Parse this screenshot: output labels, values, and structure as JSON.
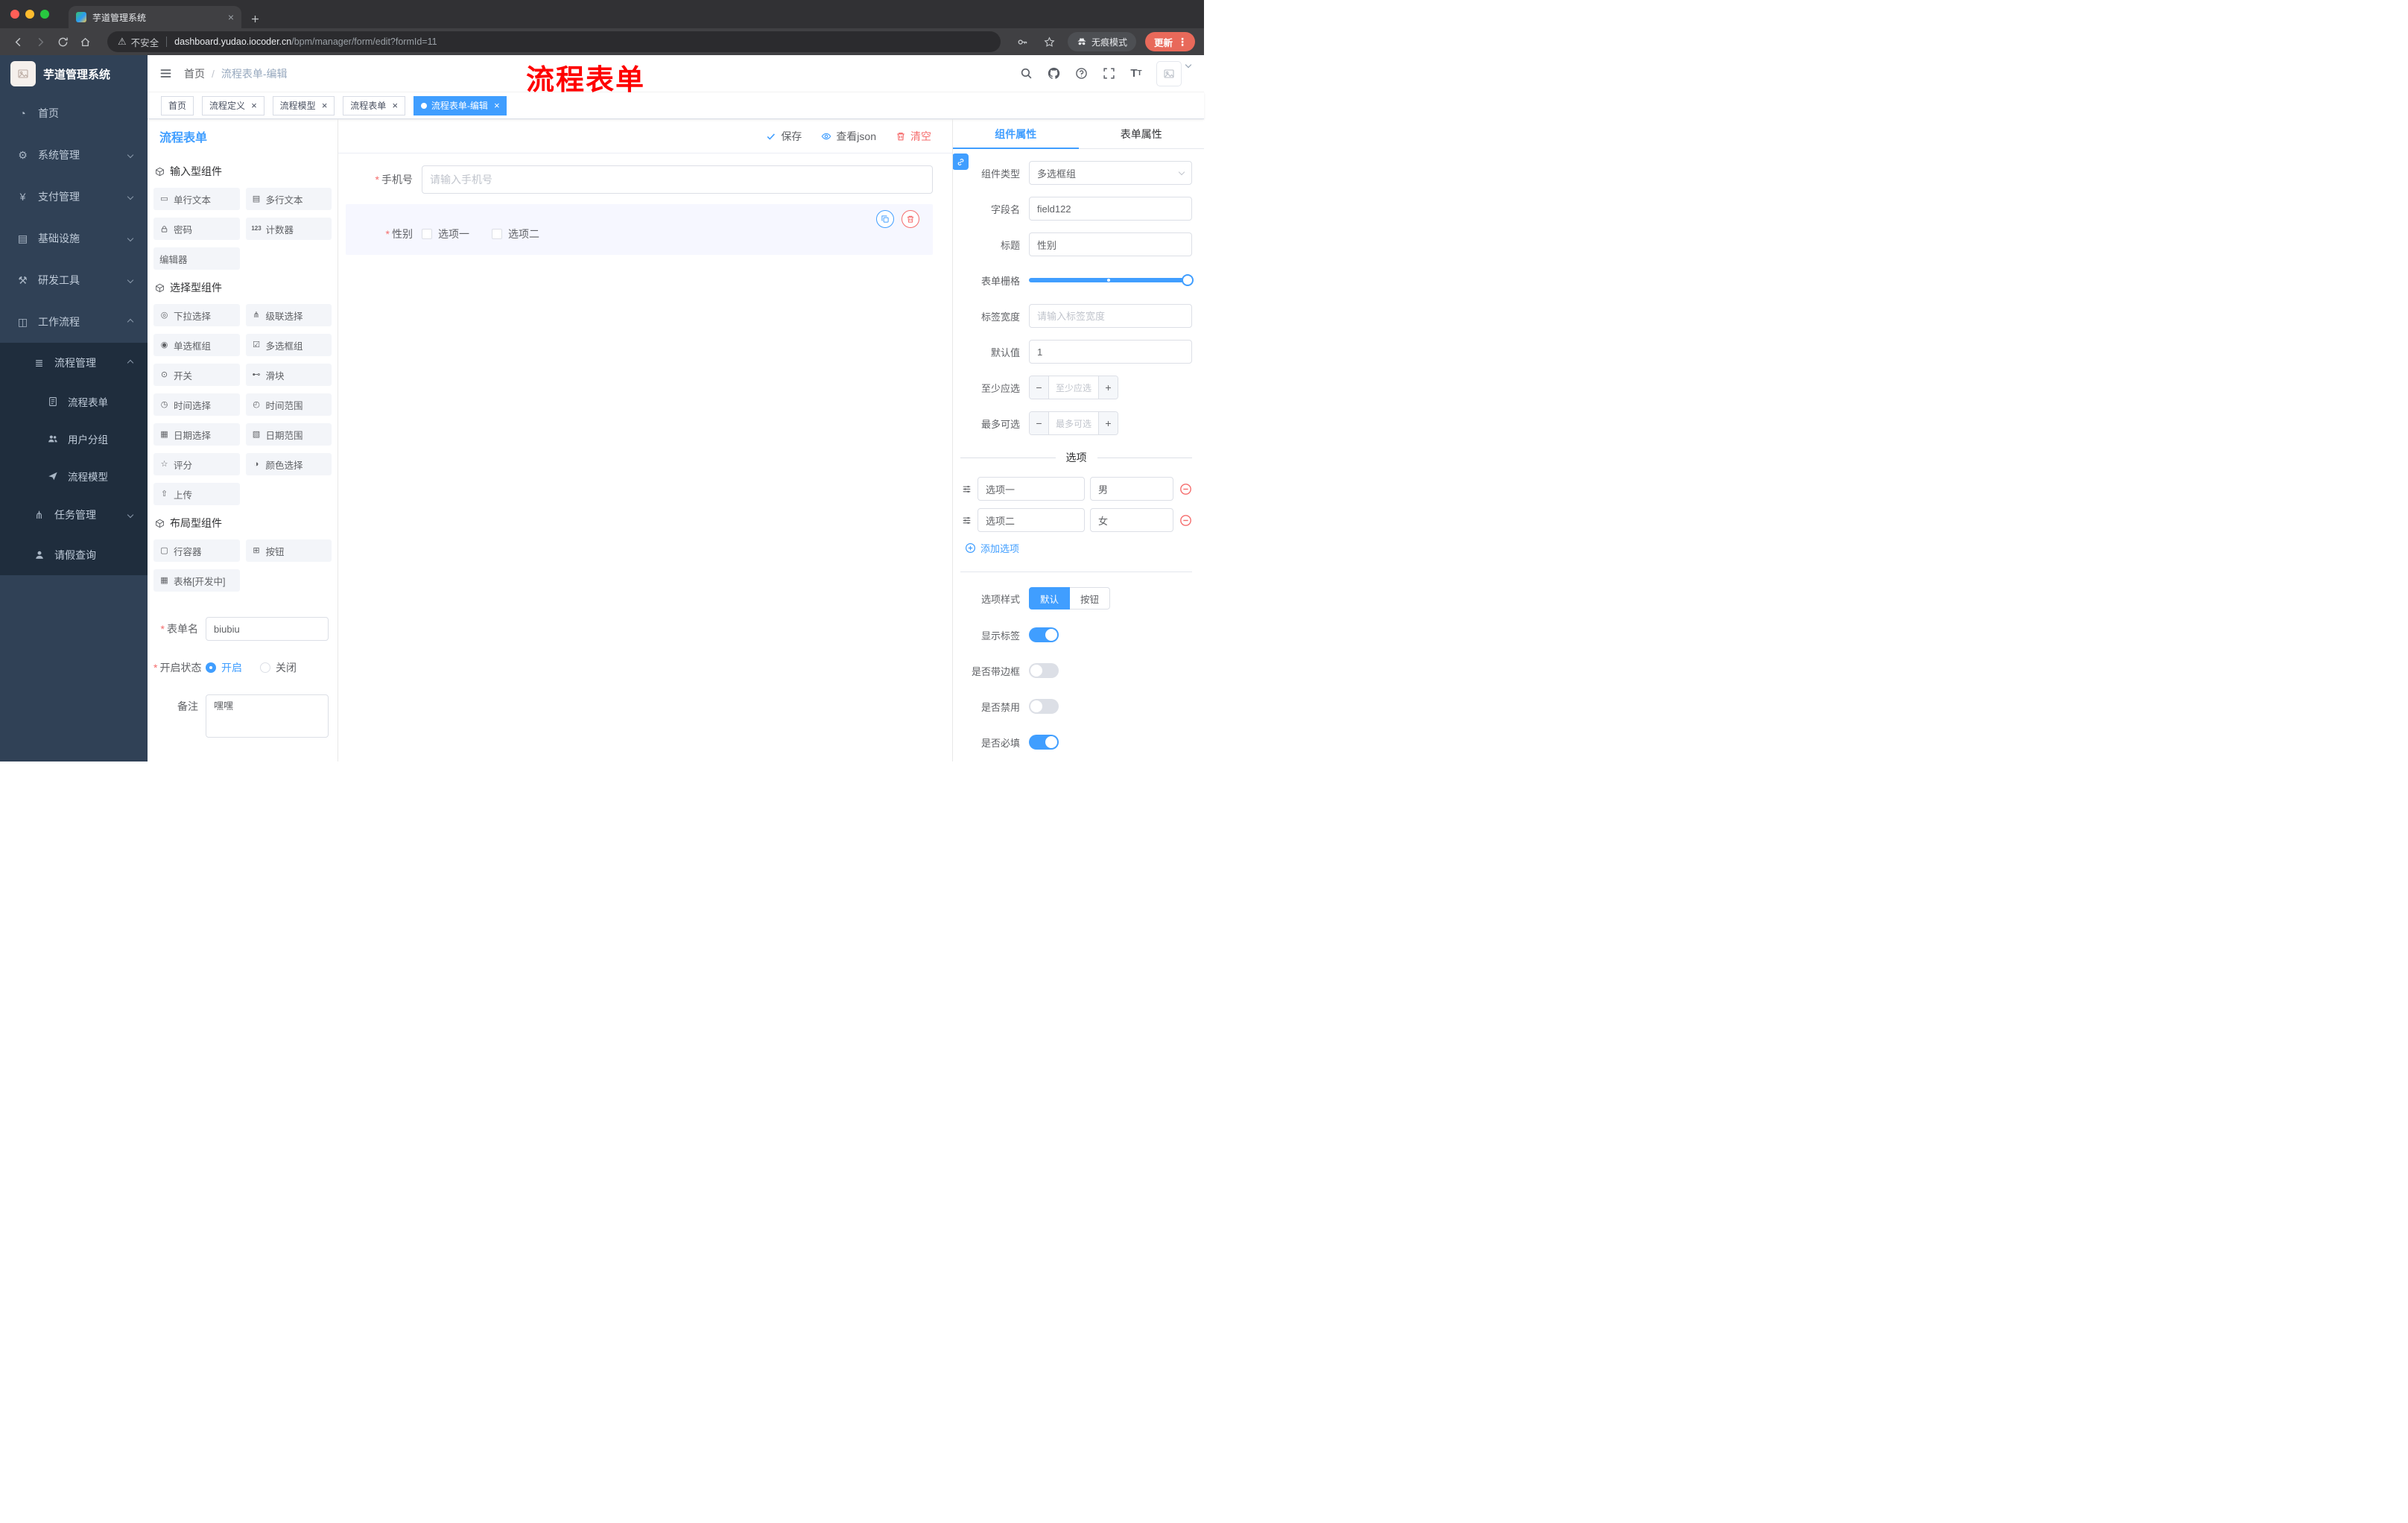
{
  "browser": {
    "tab": {
      "title": "芋道管理系统"
    },
    "address": {
      "security": "不安全",
      "url_domain": "dashboard.yudao.iocoder.cn",
      "url_path": "/bpm/manager/form/edit?formId=11"
    },
    "incognito_label": "无痕模式",
    "update_label": "更新"
  },
  "annotation": {
    "text": "流程表单",
    "color": "#fe0000"
  },
  "sidebar": {
    "logo_title": "芋道管理系统",
    "items": [
      {
        "label": "首页",
        "icon": "dashboard-icon",
        "level": 1
      },
      {
        "label": "系统管理",
        "icon": "gear-icon",
        "level": 1,
        "chevron": "down"
      },
      {
        "label": "支付管理",
        "icon": "yen-icon",
        "level": 1,
        "chevron": "down"
      },
      {
        "label": "基础设施",
        "icon": "infrastructure-icon",
        "level": 1,
        "chevron": "down"
      },
      {
        "label": "研发工具",
        "icon": "devtools-icon",
        "level": 1,
        "chevron": "down"
      },
      {
        "label": "工作流程",
        "icon": "workflow-icon",
        "level": 1,
        "chevron": "up"
      },
      {
        "label": "流程管理",
        "icon": "process-manage-icon",
        "level": 2,
        "chevron": "up"
      },
      {
        "label": "流程表单",
        "icon": "process-form-icon",
        "level": 3
      },
      {
        "label": "用户分组",
        "icon": "user-group-icon",
        "level": 3
      },
      {
        "label": "流程模型",
        "icon": "process-model-icon",
        "level": 3
      },
      {
        "label": "任务管理",
        "icon": "task-manage-icon",
        "level": 2,
        "chevron": "down"
      },
      {
        "label": "请假查询",
        "icon": "leave-query-icon",
        "level": 2
      }
    ]
  },
  "header": {
    "breadcrumb": [
      "首页",
      "流程表单-编辑"
    ],
    "breadcrumb_separator": "/"
  },
  "tags": [
    {
      "label": "首页",
      "closable": false,
      "active": false
    },
    {
      "label": "流程定义",
      "closable": true,
      "active": false
    },
    {
      "label": "流程模型",
      "closable": true,
      "active": false
    },
    {
      "label": "流程表单",
      "closable": true,
      "active": false
    },
    {
      "label": "流程表单-编辑",
      "closable": true,
      "active": true
    }
  ],
  "palette": {
    "title": "流程表单",
    "sections": [
      {
        "title": "输入型组件",
        "items": [
          {
            "label": "单行文本",
            "icon": "single-line-icon"
          },
          {
            "label": "多行文本",
            "icon": "multi-line-icon"
          },
          {
            "label": "密码",
            "icon": "password-icon"
          },
          {
            "label": "计数器",
            "icon": "counter-icon"
          },
          {
            "label": "编辑器",
            "icon": ""
          }
        ]
      },
      {
        "title": "选择型组件",
        "items": [
          {
            "label": "下拉选择",
            "icon": "select-icon"
          },
          {
            "label": "级联选择",
            "icon": "cascader-icon"
          },
          {
            "label": "单选框组",
            "icon": "radio-icon"
          },
          {
            "label": "多选框组",
            "icon": "checkbox-icon"
          },
          {
            "label": "开关",
            "icon": "switch-icon"
          },
          {
            "label": "滑块",
            "icon": "slider-icon"
          },
          {
            "label": "时间选择",
            "icon": "time-icon"
          },
          {
            "label": "时间范围",
            "icon": "time-range-icon"
          },
          {
            "label": "日期选择",
            "icon": "date-icon"
          },
          {
            "label": "日期范围",
            "icon": "date-range-icon"
          },
          {
            "label": "评分",
            "icon": "rate-icon"
          },
          {
            "label": "颜色选择",
            "icon": "color-icon"
          },
          {
            "label": "上传",
            "icon": "upload-icon"
          }
        ]
      },
      {
        "title": "布局型组件",
        "items": [
          {
            "label": "行容器",
            "icon": "row-icon"
          },
          {
            "label": "按钮",
            "icon": "button-icon"
          },
          {
            "label": "表格[开发中]",
            "icon": "table-icon"
          }
        ]
      }
    ],
    "form": {
      "name_label": "表单名",
      "name_value": "biubiu",
      "status_label": "开启状态",
      "status_options": [
        "开启",
        "关闭"
      ],
      "status_selected": "开启",
      "remark_label": "备注",
      "remark_value": "嘿嘿"
    }
  },
  "canvas": {
    "toolbar": {
      "save": "保存",
      "view_json": "查看json",
      "clear": "清空"
    },
    "fields": {
      "phone": {
        "label": "手机号",
        "placeholder": "请输入手机号",
        "required": true
      },
      "gender": {
        "label": "性别",
        "required": true,
        "options": [
          "选项一",
          "选项二"
        ]
      }
    }
  },
  "inspector": {
    "tabs": [
      "组件属性",
      "表单属性"
    ],
    "active_tab": "组件属性",
    "fields": {
      "component_type": {
        "label": "组件类型",
        "value": "多选框组"
      },
      "field_name": {
        "label": "字段名",
        "value": "field122"
      },
      "title": {
        "label": "标题",
        "value": "性别"
      },
      "grid": {
        "label": "表单栅格"
      },
      "label_width": {
        "label": "标签宽度",
        "placeholder": "请输入标签宽度"
      },
      "default_value": {
        "label": "默认值",
        "value": "1"
      },
      "min_select": {
        "label": "至少应选",
        "placeholder": "至少应选"
      },
      "max_select": {
        "label": "最多可选",
        "placeholder": "最多可选"
      }
    },
    "options_section": {
      "title": "选项",
      "options": [
        {
          "name": "选项一",
          "value": "男"
        },
        {
          "name": "选项二",
          "value": "女"
        }
      ],
      "add_label": "添加选项"
    },
    "style_section": {
      "label": "选项样式",
      "choices": [
        "默认",
        "按钮"
      ],
      "selected": "默认"
    },
    "switches": [
      {
        "label": "显示标签",
        "on": true
      },
      {
        "label": "是否带边框",
        "on": false
      },
      {
        "label": "是否禁用",
        "on": false
      },
      {
        "label": "是否必填",
        "on": true
      }
    ]
  },
  "colors": {
    "accent": "#409eff",
    "danger": "#f56c6c",
    "annotation": "#fe0000"
  }
}
